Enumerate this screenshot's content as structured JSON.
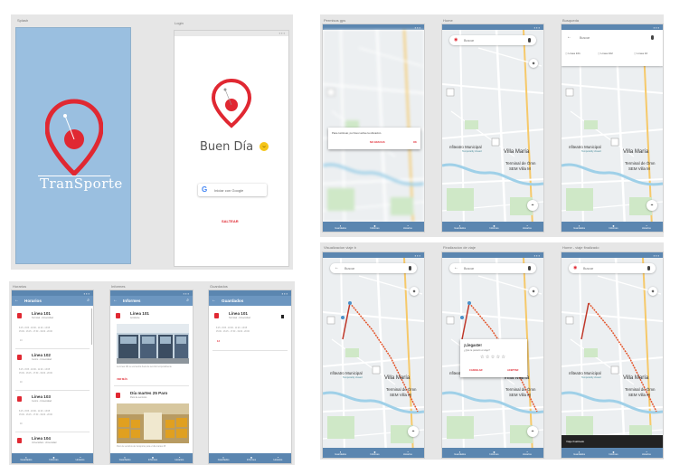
{
  "captions": {
    "splash": "Splash",
    "login": "Login",
    "permisos": "Permisos gps",
    "home": "Home",
    "busqueda": "Busqueda",
    "horarios": "Horarios",
    "informes": "Informes",
    "guardados": "Guardados",
    "visualizacion": "Visualizacion viaje b",
    "finalizacion": "Finalizacion de viaje",
    "viaje_finalizado": "Home - viaje finalizado"
  },
  "splash": {
    "logo_text": "TranSporte"
  },
  "login": {
    "greeting": "Buen Día",
    "google_button": "Iniciar con Google",
    "skip": "SALTEAR"
  },
  "nav": {
    "guardados": "Guardados",
    "informes": "Informes",
    "horarios": "Horarios"
  },
  "permission_dialog": {
    "message": "Para continuar, por favor active la ubicación.",
    "cancel": "NO GRACIAS",
    "ok": "OK"
  },
  "search": {
    "placeholder": "Buscar",
    "chips": [
      "Línea 101",
      "Línea 102",
      "Línea 10"
    ]
  },
  "map_labels": {
    "city": "Villa María",
    "anfiteatro": "nfiteatro Municipal",
    "temp_closed": "Temporarily closed",
    "terminal": "Terminal de Ómn",
    "sem": "SEM Villa M"
  },
  "horarios": {
    "title": "Horarios",
    "lines": [
      {
        "name": "Línea 101",
        "route": "Terminal - Universidad",
        "times": "6:15 - 8:05 - 10:00 - 11:20 - 13:05",
        "times2": "15:00 - 16:15 - 17:30 - 19:00 - 20:00",
        "badge": "13"
      },
      {
        "name": "Línea 102",
        "route": "Centro - Universidad",
        "times": "6:15 - 8:05 - 10:00 - 11:20 - 13:05",
        "times2": "15:00 - 16:15 - 17:30 - 19:00 - 20:00",
        "badge": "10"
      },
      {
        "name": "Línea 103",
        "route": "Centro - Universidad",
        "times": "6:15 - 8:05 - 10:00 - 11:20 - 13:05",
        "times2": "15:00 - 16:15 - 17:30 - 19:00 - 20:00",
        "badge": "10"
      },
      {
        "name": "Línea 104",
        "route": "Universidad - Universidad",
        "times": "",
        "times2": "",
        "badge": ""
      }
    ]
  },
  "informes": {
    "title": "Informes",
    "items": [
      {
        "name": "Línea 101",
        "sub": "Accidente",
        "desc": "La Línea 101 se encuentra fuera de servicio temporalmente",
        "link": "VER MÁS"
      },
      {
        "name": "Día martes 25 Paro",
        "sub": "Paro de servicios",
        "desc": "Paro de servicios de transporte para el día martes 25",
        "link": ""
      }
    ]
  },
  "guardados": {
    "title": "Guardados",
    "item": {
      "name": "Línea 101",
      "route": "Terminal - Universidad",
      "times": "6:15 - 8:05 - 10:00 - 11:20 - 13:05",
      "times2": "15:00 - 16:15 - 17:30 - 19:00 - 20:00",
      "badge": "13"
    }
  },
  "rating_dialog": {
    "title": "¡Llegaste!",
    "question": "¿Qué te pareció el viaje?",
    "stars": "☆ ☆ ☆ ☆ ☆",
    "cancel": "CANCELAR",
    "accept": "ACEPTAR"
  },
  "snackbar": {
    "text": "Viaje finalizado"
  },
  "colors": {
    "primary": "#5b86b0",
    "accent": "#e02832",
    "splash_bg": "#9abfe0"
  }
}
